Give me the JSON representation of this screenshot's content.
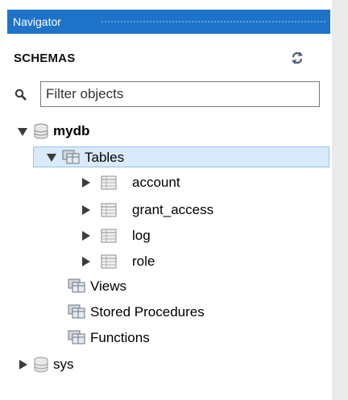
{
  "panel": {
    "title": "Navigator"
  },
  "schemas_label": "SCHEMAS",
  "filter": {
    "placeholder": "Filter objects",
    "value": ""
  },
  "tree": {
    "mydb": {
      "name": "mydb",
      "tables_label": "Tables",
      "tables": [
        "account",
        "grant_access",
        "log",
        "role"
      ],
      "views_label": "Views",
      "procedures_label": "Stored Procedures",
      "functions_label": "Functions"
    },
    "sys": {
      "name": "sys"
    }
  },
  "colors": {
    "title_bg": "#1e73c8",
    "selection_bg": "#d9ebfb",
    "selection_border": "#93c3ef"
  },
  "icons": [
    "refresh-icon",
    "search-icon",
    "database-icon",
    "table-folder-icon",
    "table-icon",
    "views-icon",
    "procedures-icon",
    "functions-icon"
  ]
}
